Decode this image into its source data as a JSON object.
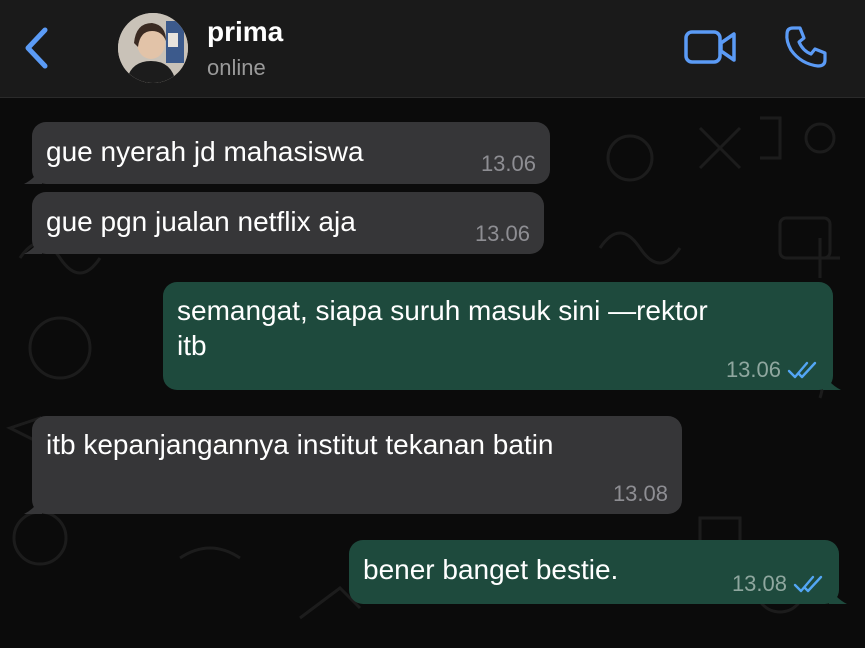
{
  "header": {
    "contact_name": "prima",
    "status": "online"
  },
  "icons": {
    "back": "chevron-left-icon",
    "video": "video-camera-icon",
    "call": "phone-icon",
    "read_receipt": "double-check-icon"
  },
  "colors": {
    "accent": "#5b9bf6",
    "incoming_bubble": "#363638",
    "outgoing_bubble": "#1e4a3d",
    "header_bg": "#1a1a1a",
    "read_tick": "#53a6f4"
  },
  "messages": [
    {
      "direction": "in",
      "text": "gue nyerah jd mahasiswa",
      "time": "13.06"
    },
    {
      "direction": "in",
      "text": "gue pgn jualan netflix aja",
      "time": "13.06"
    },
    {
      "direction": "out",
      "text_line1": "semangat, siapa suruh masuk sini —rektor",
      "text_line2": "itb",
      "time": "13.06"
    },
    {
      "direction": "in",
      "text": "itb kepanjangannya institut tekanan batin",
      "time": "13.08"
    },
    {
      "direction": "out",
      "text": "bener banget bestie.",
      "time": "13.08"
    }
  ]
}
